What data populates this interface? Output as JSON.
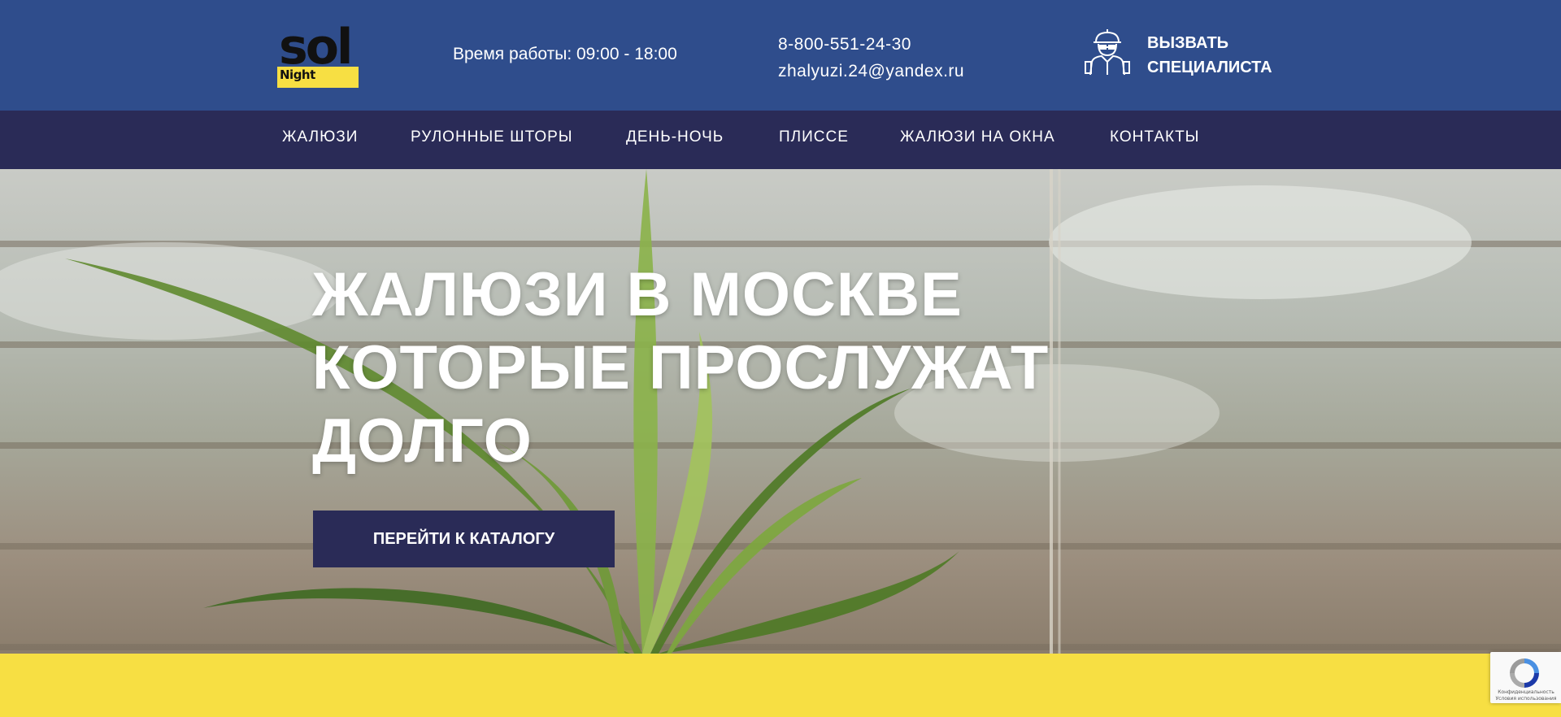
{
  "header": {
    "logo": {
      "word": "sol",
      "sub": "Night"
    },
    "hours": "Время работы: 09:00 - 18:00",
    "phone": "8-800-551-24-30",
    "email": "zhalyuzi.24@yandex.ru",
    "callout": {
      "line1": "Вызвать",
      "line2": "специалиста",
      "icon": "specialist-icon"
    }
  },
  "nav": {
    "items": [
      {
        "label": "Жалюзи"
      },
      {
        "label": "Рулонные шторы"
      },
      {
        "label": "День-ночь"
      },
      {
        "label": "Плиссе"
      },
      {
        "label": "Жалюзи на окна"
      },
      {
        "label": "Контакты"
      }
    ]
  },
  "hero": {
    "title_line1": "Жалюзи в Москве",
    "title_line2": "которые прослужат",
    "title_line3": "долго",
    "button_label": "Перейти к каталогу"
  },
  "recaptcha": {
    "privacy": "Конфиденциальность",
    "terms": "Условия использования"
  },
  "colors": {
    "header_bg": "#2f4d8c",
    "nav_bg": "#2a2b57",
    "accent_yellow": "#f7df43",
    "button_bg": "#2a2b57"
  }
}
